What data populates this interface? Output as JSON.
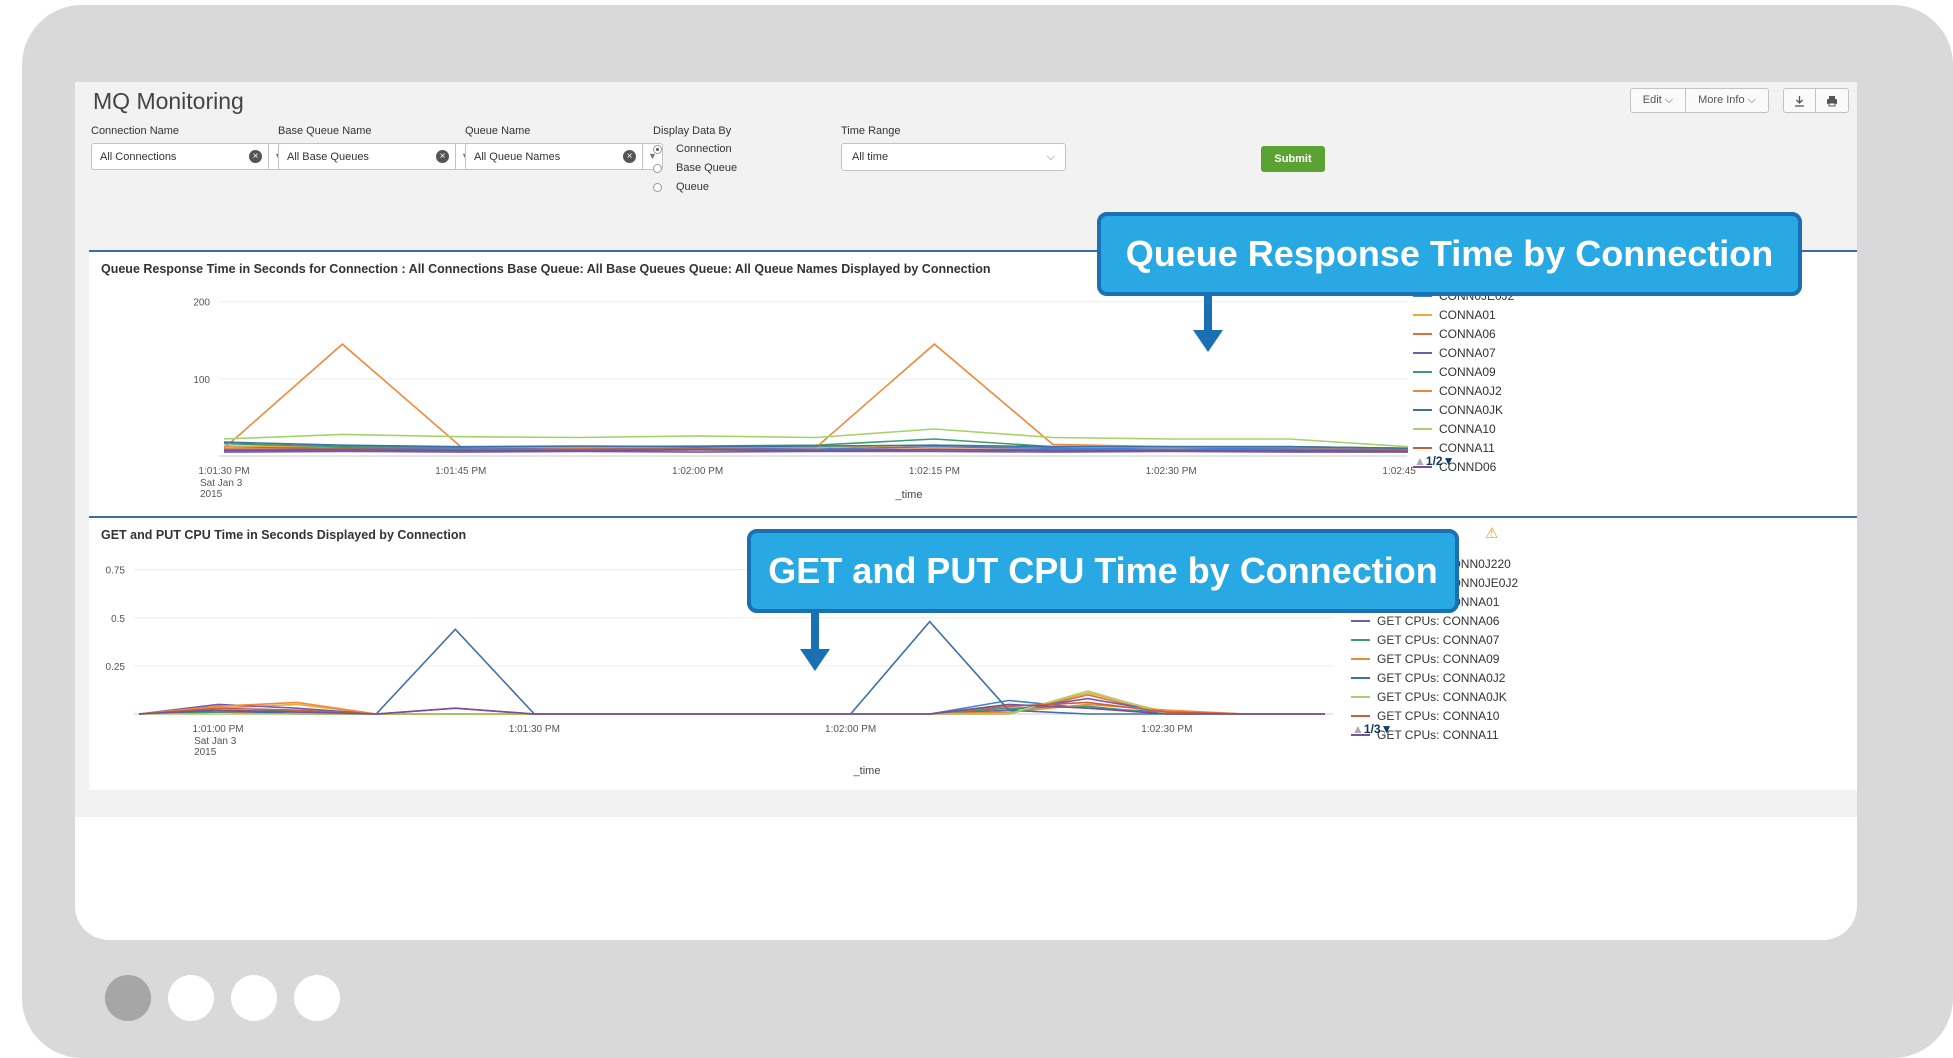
{
  "app": {
    "title": "MQ Monitoring"
  },
  "topbar": {
    "edit_label": "Edit ⌵",
    "more_info_label": "More Info ⌵",
    "download_icon": "download-icon",
    "print_icon": "print-icon"
  },
  "filters": {
    "connection": {
      "label": "Connection Name",
      "value": "All Connections"
    },
    "base_queue": {
      "label": "Base Queue Name",
      "value": "All Base Queues"
    },
    "queue": {
      "label": "Queue Name",
      "value": "All Queue Names"
    },
    "display_by": {
      "label": "Display Data By",
      "options": [
        "Connection",
        "Base Queue",
        "Queue"
      ],
      "selected": "Connection"
    },
    "time_range": {
      "label": "Time Range",
      "value": "All time"
    },
    "submit_label": "Submit"
  },
  "panel1": {
    "title": "Queue Response Time in Seconds for Connection : All Connections Base Queue: All Base Queues Queue: All Queue Names Displayed by Connection",
    "pager": "1/2",
    "legend": [
      "CONN0JE0J2",
      "CONNA01",
      "CONNA06",
      "CONNA07",
      "CONNA09",
      "CONNA0J2",
      "CONNA0JK",
      "CONNA10",
      "CONNA11",
      "CONND06"
    ]
  },
  "panel2": {
    "title": "GET and PUT CPU Time in Seconds Displayed by Connection",
    "pager": "1/3",
    "legend": [
      "GET CPUs: CONN0J220",
      "GET CPUs: CONN0JE0J2",
      "GET CPUs: CONNA01",
      "GET CPUs: CONNA06",
      "GET CPUs: CONNA07",
      "GET CPUs: CONNA09",
      "GET CPUs: CONNA0J2",
      "GET CPUs: CONNA0JK",
      "GET CPUs: CONNA10",
      "GET CPUs: CONNA11"
    ]
  },
  "callouts": {
    "c1": "Queue Response Time by Connection",
    "c2": "GET and PUT CPU Time by Connection"
  },
  "colors": {
    "accent_blue": "#29a9e3",
    "callout_border": "#1b6fb3",
    "submit_green": "#5aa333",
    "panel_rule": "#3a6ea5",
    "series": [
      "#3a86c8",
      "#f4a832",
      "#e0703a",
      "#6a5fb3",
      "#36a06f",
      "#f0883a",
      "#3d6fa8",
      "#a5d36a",
      "#c9603a",
      "#7a4fa0"
    ]
  },
  "chart_data": [
    {
      "type": "line",
      "title": "Queue Response Time in Seconds for Connection : All Connections Base Queue: All Base Queues Queue: All Queue Names Displayed by Connection",
      "xlabel": "_time",
      "ylabel": "",
      "x": [
        "1:01:30 PM",
        "1:01:37 PM",
        "1:01:45 PM",
        "1:01:52 PM",
        "1:02:00 PM",
        "1:02:07 PM",
        "1:02:15 PM",
        "1:02:22 PM",
        "1:02:30 PM",
        "1:02:37 PM",
        "1:02:45 PM"
      ],
      "x_sublabel": [
        "Sat Jan 3",
        "2015"
      ],
      "xticks": [
        "1:01:30 PM",
        "1:01:45 PM",
        "1:02:00 PM",
        "1:02:15 PM",
        "1:02:30 PM",
        "1:02:45 PM"
      ],
      "ylim": [
        0,
        210
      ],
      "yticks": [
        100,
        200
      ],
      "series": [
        {
          "name": "CONN0JE0J2",
          "values": [
            12,
            10,
            10,
            9,
            10,
            9,
            12,
            10,
            9,
            10,
            8
          ]
        },
        {
          "name": "CONNA01",
          "values": [
            13,
            12,
            11,
            12,
            12,
            11,
            14,
            12,
            11,
            12,
            10
          ]
        },
        {
          "name": "CONNA06",
          "values": [
            8,
            7,
            7,
            7,
            8,
            7,
            8,
            7,
            7,
            7,
            6
          ]
        },
        {
          "name": "CONNA07",
          "values": [
            5,
            6,
            5,
            6,
            5,
            6,
            6,
            5,
            6,
            5,
            5
          ]
        },
        {
          "name": "CONNA09",
          "values": [
            16,
            12,
            11,
            12,
            13,
            14,
            22,
            12,
            12,
            12,
            10
          ]
        },
        {
          "name": "CONNA0J2",
          "values": [
            10,
            145,
            12,
            11,
            12,
            11,
            145,
            15,
            12,
            11,
            10
          ]
        },
        {
          "name": "CONNA0JK",
          "values": [
            18,
            14,
            12,
            13,
            12,
            13,
            14,
            12,
            12,
            12,
            10
          ]
        },
        {
          "name": "CONNA10",
          "values": [
            22,
            28,
            25,
            24,
            26,
            24,
            35,
            24,
            22,
            22,
            12
          ]
        },
        {
          "name": "CONNA11",
          "values": [
            9,
            9,
            8,
            9,
            9,
            8,
            9,
            8,
            8,
            8,
            7
          ]
        },
        {
          "name": "CONND06",
          "values": [
            7,
            8,
            7,
            7,
            8,
            7,
            8,
            7,
            7,
            7,
            6
          ]
        }
      ]
    },
    {
      "type": "line",
      "title": "GET and PUT CPU Time in Seconds Displayed by Connection",
      "xlabel": "_time",
      "ylabel": "",
      "x": [
        "1:00:52 PM",
        "1:01:00 PM",
        "1:01:07 PM",
        "1:01:15 PM",
        "1:01:22 PM",
        "1:01:30 PM",
        "1:01:37 PM",
        "1:01:45 PM",
        "1:01:52 PM",
        "1:02:00 PM",
        "1:02:07 PM",
        "1:02:15 PM",
        "1:02:22 PM",
        "1:02:30 PM",
        "1:02:37 PM",
        "1:02:45 PM"
      ],
      "x_sublabel": [
        "Sat Jan 3",
        "2015"
      ],
      "xticks": [
        "1:01:00 PM",
        "1:01:30 PM",
        "1:02:00 PM",
        "1:02:30 PM"
      ],
      "ylim": [
        0,
        0.8
      ],
      "yticks": [
        0.25,
        0.5,
        0.75
      ],
      "series": [
        {
          "name": "GET CPUs: CONN0J220",
          "values": [
            0,
            0.02,
            0.01,
            0,
            0,
            0,
            0,
            0,
            0,
            0,
            0,
            0.07,
            0.03,
            0.01,
            0,
            0
          ]
        },
        {
          "name": "GET CPUs: CONN0JE0J2",
          "values": [
            0,
            0.03,
            0.05,
            0,
            0,
            0,
            0,
            0,
            0,
            0,
            0,
            0,
            0.11,
            0.01,
            0,
            0
          ]
        },
        {
          "name": "GET CPUs: CONNA01",
          "values": [
            0,
            0.01,
            0,
            0,
            0,
            0,
            0,
            0,
            0,
            0,
            0,
            0,
            0.1,
            0,
            0,
            0
          ]
        },
        {
          "name": "GET CPUs: CONNA06",
          "values": [
            0,
            0.05,
            0.03,
            0,
            0,
            0,
            0,
            0,
            0,
            0,
            0,
            0.02,
            0.08,
            0.01,
            0,
            0
          ]
        },
        {
          "name": "GET CPUs: CONNA07",
          "values": [
            0,
            0.01,
            0.02,
            0,
            0,
            0,
            0,
            0,
            0,
            0,
            0,
            0.03,
            0.04,
            0,
            0,
            0
          ]
        },
        {
          "name": "GET CPUs: CONNA09",
          "values": [
            0,
            0.04,
            0.06,
            0,
            0,
            0,
            0,
            0,
            0,
            0,
            0,
            0.01,
            0.05,
            0.02,
            0,
            0
          ]
        },
        {
          "name": "GET CPUs: CONNA0J2",
          "values": [
            0,
            0.02,
            0,
            0,
            0.44,
            0,
            0,
            0,
            0,
            0,
            0.48,
            0.02,
            0,
            0,
            0,
            0
          ]
        },
        {
          "name": "GET CPUs: CONNA0JK",
          "values": [
            0,
            0,
            0,
            0,
            0,
            0,
            0,
            0,
            0,
            0,
            0,
            0,
            0.12,
            0,
            0,
            0
          ]
        },
        {
          "name": "GET CPUs: CONNA10",
          "values": [
            0,
            0.03,
            0.02,
            0,
            0.03,
            0,
            0,
            0,
            0,
            0,
            0,
            0.04,
            0.06,
            0.01,
            0,
            0
          ]
        },
        {
          "name": "GET CPUs: CONNA11",
          "values": [
            0,
            0.02,
            0.01,
            0,
            0.03,
            0,
            0,
            0,
            0,
            0,
            0,
            0.05,
            0.03,
            0,
            0,
            0
          ]
        }
      ]
    }
  ]
}
